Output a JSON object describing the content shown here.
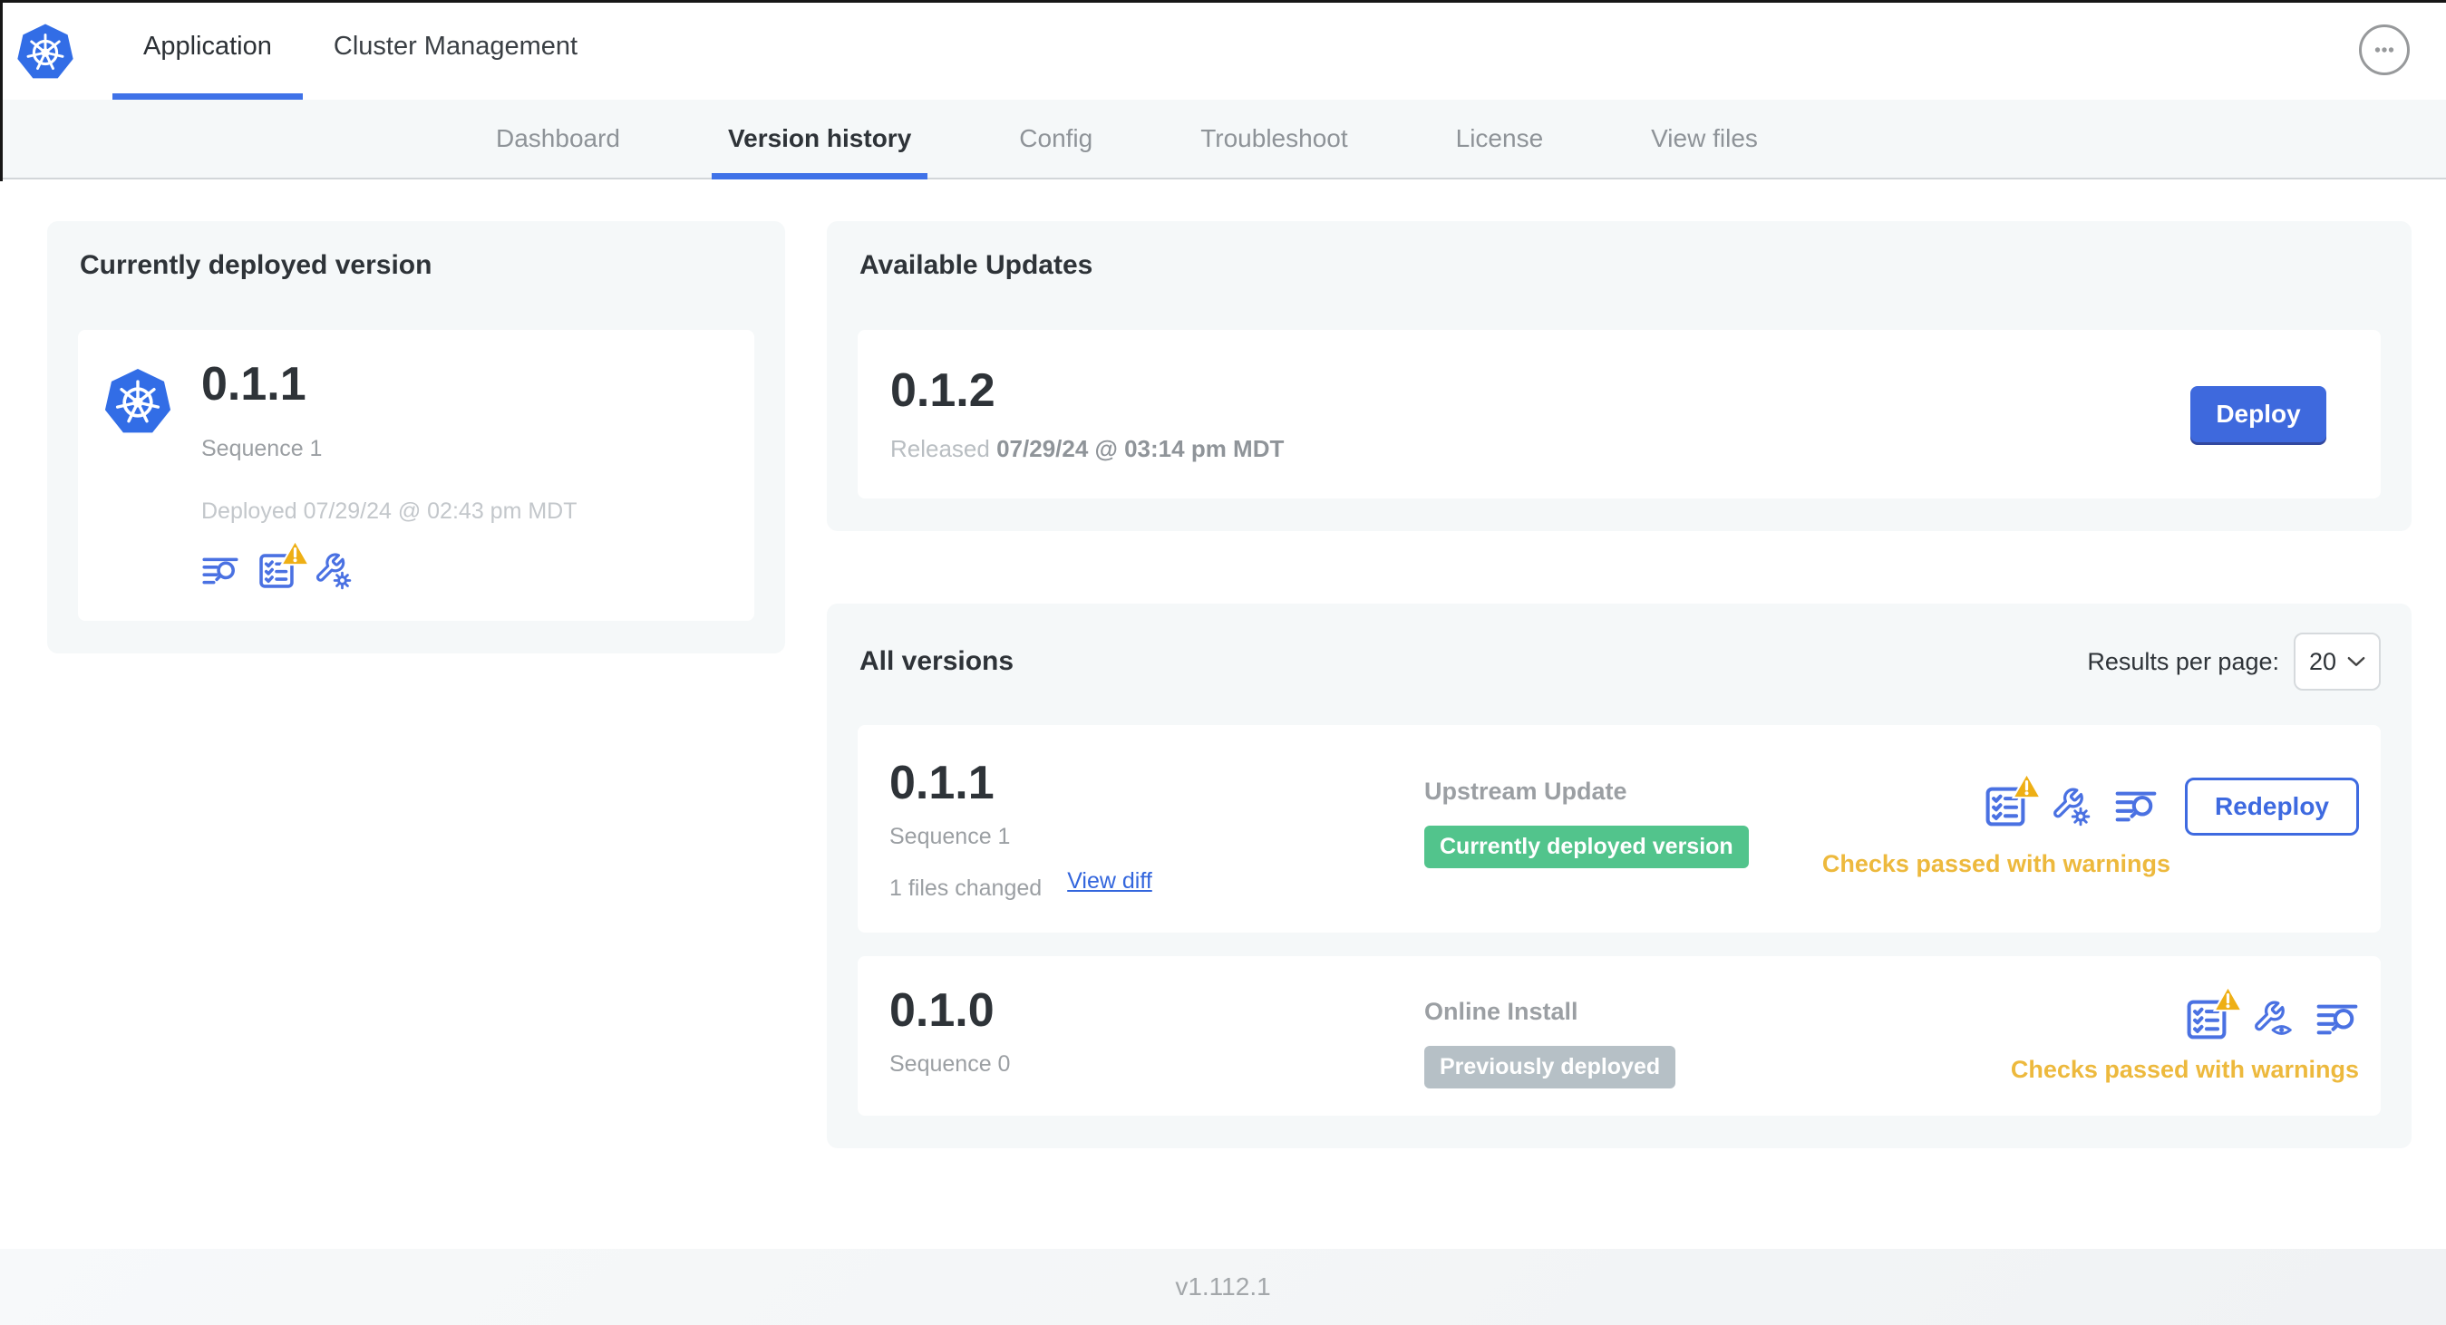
{
  "header": {
    "tabs": [
      {
        "label": "Application",
        "active": true
      },
      {
        "label": "Cluster Management",
        "active": false
      }
    ],
    "logo_icon": "kubernetes-logo-icon",
    "menu_icon": "ellipsis-icon"
  },
  "subnav": {
    "tabs": [
      "Dashboard",
      "Version history",
      "Config",
      "Troubleshoot",
      "License",
      "View files"
    ],
    "active_tab": "Version history"
  },
  "current_version": {
    "title": "Currently deployed version",
    "version": "0.1.1",
    "sequence": "Sequence 1",
    "deployed": "Deployed 07/29/24 @ 02:43 pm MDT",
    "icons": [
      "diff-logs-icon",
      "preflight-checks-warning-icon",
      "edit-config-icon"
    ]
  },
  "available_updates": {
    "title": "Available Updates",
    "version": "0.1.2",
    "released_prefix": "Released",
    "released_date": "07/29/24 @ 03:14 pm MDT",
    "deploy_label": "Deploy"
  },
  "all_versions": {
    "title": "All versions",
    "results_per_page_label": "Results per page:",
    "results_per_page_value": "20",
    "select_icon": "chevron-down-icon",
    "rows": [
      {
        "version": "0.1.1",
        "sequence": "Sequence 1",
        "files_changed": "1 files changed",
        "view_diff_label": "View diff",
        "source": "Upstream Update",
        "badge_label": "Currently deployed version",
        "badge_color": "#52c48c",
        "status": "Checks passed with warnings",
        "action_label": "Redeploy",
        "icons": [
          "preflight-checks-warning-icon",
          "edit-config-icon",
          "diff-logs-icon"
        ]
      },
      {
        "version": "0.1.0",
        "sequence": "Sequence 0",
        "source": "Online Install",
        "badge_label": "Previously deployed",
        "badge_color": "#b6c0c6",
        "status": "Checks passed with warnings",
        "icons": [
          "preflight-checks-warning-icon",
          "view-config-icon",
          "diff-logs-icon"
        ]
      }
    ]
  },
  "footer": {
    "version": "v1.112.1"
  },
  "colors": {
    "accent_blue": "#3f72e8",
    "button_blue": "#3e69dd",
    "icon_blue": "#4a71e2",
    "link_blue": "#3366dd",
    "badge_green": "#52c48c",
    "badge_gray": "#b6c0c6",
    "warning_amber": "#edb93d",
    "warning_triangle": "#eeaf15",
    "panel_gray": "#f5f8f9"
  }
}
